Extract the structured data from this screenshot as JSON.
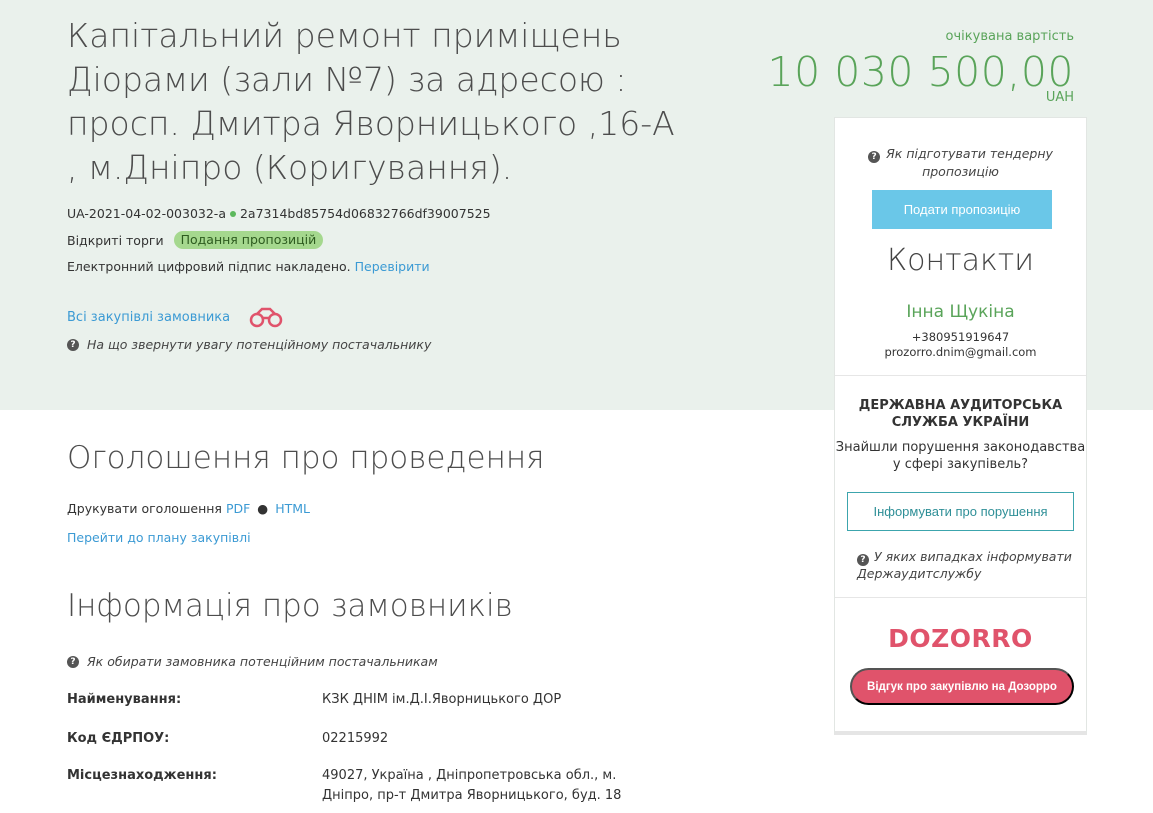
{
  "tender": {
    "title": "Капітальний ремонт приміщень Діорами (зали №7) за адресою : просп. Дмитра Яворницького ,16-А , м.Дніпро (Коригування).",
    "id": "UA-2021-04-02-003032-a",
    "hash": "2a7314bd85754d06832766df39007525",
    "procedure": "Відкриті торги",
    "status": "Подання пропозицій",
    "signature_text": "Електронний цифровий підпис накладено.",
    "signature_link": "Перевірити",
    "all_purchases_link": "Всі закупівлі замовника",
    "hint_potential": "На що звернути увагу потенційному постачальнику"
  },
  "price": {
    "label": "очікувана вартість",
    "value": "10 030 500,00",
    "currency": "UAH"
  },
  "sidebar": {
    "prepare_hint": "Як підготувати тендерну пропозицію",
    "submit_button": "Подати пропозицію",
    "contacts_title": "Контакти",
    "contact_name": "Інна Щукіна",
    "contact_phone": "+380951919647",
    "contact_email": "prozorro.dnim@gmail.com",
    "audit_title": "ДЕРЖАВНА АУДИТОРСЬКА СЛУЖБА УКРАЇНИ",
    "audit_text": "Знайшли порушення законодавства у сфері закупівель?",
    "inform_button": "Інформувати про порушення",
    "inform_hint": "У яких випадках інформувати Держаудитслужбу",
    "dozorro_logo": "DOZORRO",
    "dozorro_button": "Відгук про закупівлю на Дозорро"
  },
  "announcement": {
    "title": "Оголошення про проведення",
    "print_label": "Друкувати оголошення",
    "print_pdf": "PDF",
    "print_html": "HTML",
    "plan_link": "Перейти до плану закупівлі"
  },
  "customers": {
    "title": "Інформація про замовників",
    "hint": "Як обирати замовника потенційним постачальникам",
    "rows": [
      {
        "label": "Найменування:",
        "value": "КЗК ДНІМ ім.Д.І.Яворницького ДОР"
      },
      {
        "label": "Код ЄДРПОУ:",
        "value": "02215992"
      },
      {
        "label": "Місцезнаходження:",
        "value": "49027, Україна , Дніпропетровська обл., м. Дніпро, пр-т Дмитра Яворницького, буд. 18"
      }
    ]
  },
  "colors": {
    "hero_bg": "#eaf1ec",
    "price_green": "#5aa45a",
    "link_blue": "#3b9ad4",
    "dozorro_red": "#e0536b",
    "submit_blue": "#6ac7e8",
    "status_badge": "#a5d88e"
  }
}
